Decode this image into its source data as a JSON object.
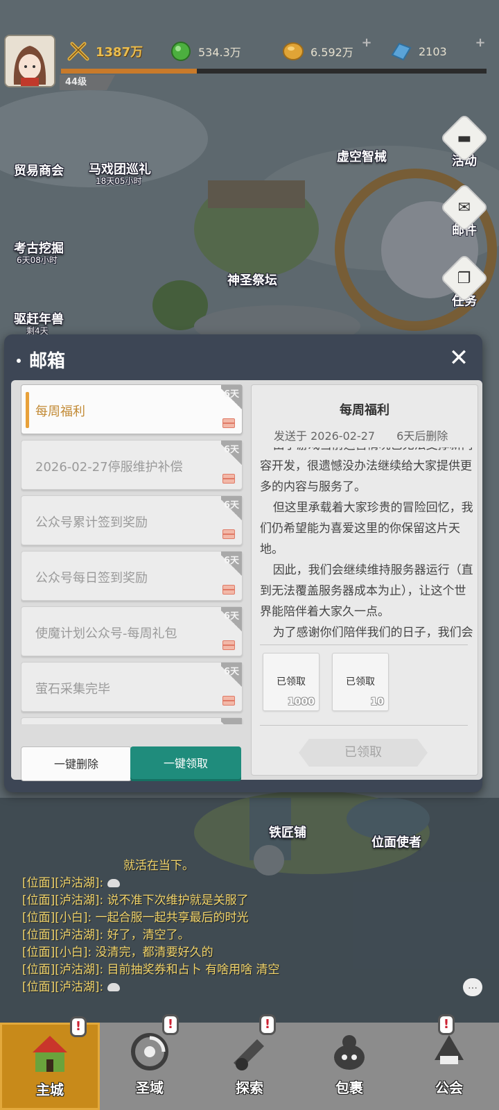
{
  "topbar": {
    "level": "44级",
    "power": "1387万",
    "resources": [
      {
        "name": "green-gem",
        "value": "534.3万",
        "icon": "green-orb-icon"
      },
      {
        "name": "gold",
        "value": "6.592万",
        "icon": "gold-coin-icon"
      },
      {
        "name": "diamond",
        "value": "2103",
        "icon": "blue-crystal-icon"
      }
    ],
    "xp_progress": 0.32
  },
  "map": {
    "buildings": [
      {
        "label": "贸易商会"
      },
      {
        "label": "马戏团巡礼",
        "timer": "18天05小时"
      },
      {
        "label": "虚空智械"
      },
      {
        "label": "考古挖掘",
        "timer": "6天08小时"
      },
      {
        "label": "神圣祭坛"
      },
      {
        "label": "驱赶年兽",
        "timer": "剩4天"
      },
      {
        "label": "铁匠铺"
      },
      {
        "label": "位面使者"
      }
    ],
    "side_buttons": [
      {
        "label": "活动",
        "icon": "chat-icon"
      },
      {
        "label": "邮件",
        "icon": "mail-icon"
      },
      {
        "label": "任务",
        "icon": "task-icon"
      }
    ]
  },
  "mailbox": {
    "title": "邮箱",
    "mails": [
      {
        "title": "每周福利",
        "days": "6天",
        "active": true
      },
      {
        "title": "2026-02-27停服维护补偿",
        "days": "6天",
        "active": false
      },
      {
        "title": "公众号累计签到奖励",
        "days": "6天",
        "active": false
      },
      {
        "title": "公众号每日签到奖励",
        "days": "6天",
        "active": false
      },
      {
        "title": "使魔计划公众号-每周礼包",
        "days": "6天",
        "active": false
      },
      {
        "title": "萤石采集完毕",
        "days": "6天",
        "active": false
      }
    ],
    "delete_all": "一键删除",
    "claim_all": "一键领取",
    "detail": {
      "title": "每周福利",
      "sent": "发送于 2026-02-27",
      "expire": "6天后删除",
      "body": [
        "由于游戏当前运营情况已无法支撑新内容开发，很遗憾没办法继续给大家提供更多的内容与服务了。",
        "但这里承载着大家珍贵的冒险回忆，我们仍希望能为喜爱这里的你保留这片天地。",
        "因此，我们会继续维持服务器运行（直到无法覆盖服务器成本为止），让这个世界能陪伴着大家久一点。",
        "为了感谢你们陪伴我们的日子，我们会"
      ],
      "rewards": [
        {
          "label": "已领取",
          "qty": "1000"
        },
        {
          "label": "已领取",
          "qty": "10"
        }
      ],
      "claimed_label": "已领取"
    }
  },
  "chat": [
    {
      "channel": "",
      "text": "就活在当下。",
      "emoji": false
    },
    {
      "channel": "[位面][泸沽湖]:",
      "text": "",
      "emoji": true
    },
    {
      "channel": "[位面][泸沽湖]:",
      "text": "说不准下次维护就是关服了",
      "emoji": false
    },
    {
      "channel": "[位面][小白]:",
      "text": "一起合服一起共享最后的时光",
      "emoji": false
    },
    {
      "channel": "[位面][泸沽湖]:",
      "text": "好了，清空了。",
      "emoji": false
    },
    {
      "channel": "[位面][小白]:",
      "text": "没清完，都清要好久的",
      "emoji": false
    },
    {
      "channel": "[位面][泸沽湖]:",
      "text": "目前抽奖券和占卜 有啥用啥 清空",
      "emoji": false
    },
    {
      "channel": "[位面][泸沽湖]:",
      "text": "",
      "emoji": true
    }
  ],
  "nav": [
    {
      "label": "主城",
      "active": true,
      "badge": true
    },
    {
      "label": "圣域",
      "active": false,
      "badge": true
    },
    {
      "label": "探索",
      "active": false,
      "badge": true
    },
    {
      "label": "包裹",
      "active": false,
      "badge": false
    },
    {
      "label": "公会",
      "active": false,
      "badge": true
    }
  ],
  "colors": {
    "accent_teal": "#1f8c7c",
    "active_orange": "#e8a13a",
    "chat_yellow": "#f2d46a"
  }
}
